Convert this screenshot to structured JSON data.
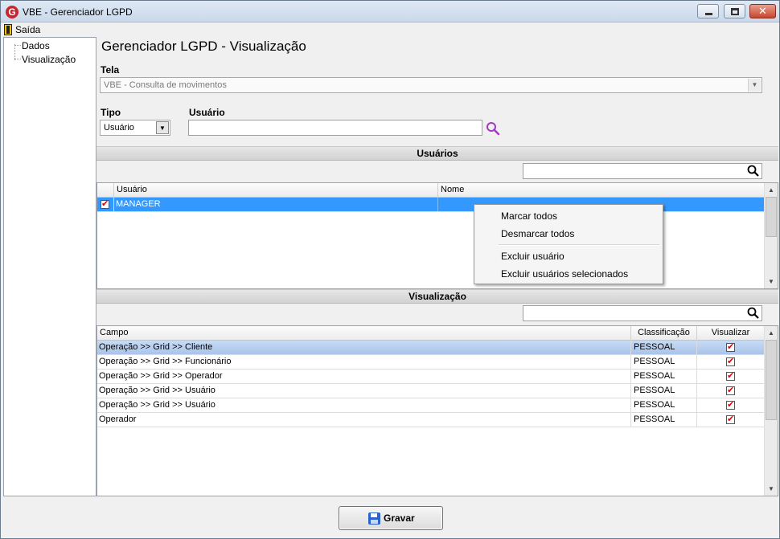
{
  "window": {
    "title": "VBE - Gerenciador LGPD",
    "app_icon_letter": "G"
  },
  "menu": {
    "exit_label": "Saída"
  },
  "tree": {
    "items": [
      {
        "label": "Dados"
      },
      {
        "label": "Visualização"
      }
    ]
  },
  "page": {
    "title": "Gerenciador LGPD - Visualização"
  },
  "form": {
    "tela_label": "Tela",
    "tela_value": "VBE - Consulta de movimentos",
    "tipo_label": "Tipo",
    "tipo_value": "Usuário",
    "usuario_label": "Usuário",
    "usuario_value": ""
  },
  "users_section": {
    "title": "Usuários",
    "filter_value": "",
    "columns": [
      "Usuário",
      "Nome"
    ],
    "rows": [
      {
        "checked": true,
        "usuario": "MANAGER",
        "nome": ""
      }
    ]
  },
  "context_menu": {
    "items": [
      "Marcar todos",
      "Desmarcar todos",
      "Excluir usuário",
      "Excluir usuários selecionados"
    ]
  },
  "view_section": {
    "title": "Visualização",
    "filter_value": "",
    "columns": [
      "Campo",
      "Classificação",
      "Visualizar"
    ],
    "rows": [
      {
        "campo": "Operação >> Grid >> Cliente",
        "classificacao": "PESSOAL",
        "visualizar": true
      },
      {
        "campo": "Operação >> Grid >> Funcionário",
        "classificacao": "PESSOAL",
        "visualizar": true
      },
      {
        "campo": "Operação >> Grid >> Operador",
        "classificacao": "PESSOAL",
        "visualizar": true
      },
      {
        "campo": "Operação >> Grid >> Usuário",
        "classificacao": "PESSOAL",
        "visualizar": true
      },
      {
        "campo": "Operação >> Grid >> Usuário",
        "classificacao": "PESSOAL",
        "visualizar": true
      },
      {
        "campo": "Operador",
        "classificacao": "PESSOAL",
        "visualizar": true
      }
    ]
  },
  "footer": {
    "save_label": "Gravar"
  },
  "colors": {
    "selection_blue": "#3399ff",
    "check_red": "#dd0000",
    "search_purple": "#a23bbf"
  }
}
